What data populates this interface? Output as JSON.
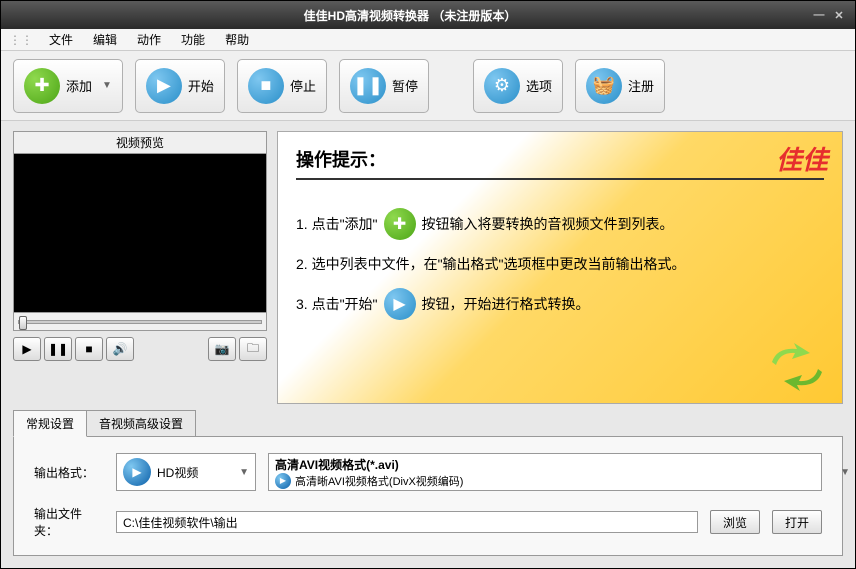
{
  "titlebar": {
    "title": "佳佳HD高清视频转换器    （未注册版本）"
  },
  "menu": {
    "file": "文件",
    "edit": "编辑",
    "action": "动作",
    "function": "功能",
    "help": "帮助"
  },
  "toolbar": {
    "add": "添加",
    "start": "开始",
    "stop": "停止",
    "pause": "暂停",
    "options": "选项",
    "register": "注册"
  },
  "preview": {
    "title": "视频预览"
  },
  "instructions": {
    "title": "操作提示：",
    "brand": "佳佳",
    "line1_a": "1. 点击\"添加\"",
    "line1_b": "按钮输入将要转换的音视频文件到列表。",
    "line2": "2. 选中列表中文件，在\"输出格式\"选项框中更改当前输出格式。",
    "line3_a": "3. 点击\"开始\"",
    "line3_b": "按钮，开始进行格式转换。"
  },
  "tabs": {
    "general": "常规设置",
    "advanced": "音视频高级设置"
  },
  "form": {
    "output_format_label": "输出格式：",
    "combo1": "HD视频",
    "combo2_title": "高清AVI视频格式(*.avi)",
    "combo2_sub": "高清晰AVI视频格式(DivX视频编码)",
    "output_folder_label": "输出文件夹：",
    "output_folder_value": "C:\\佳佳视频软件\\输出",
    "browse": "浏览",
    "open": "打开"
  }
}
